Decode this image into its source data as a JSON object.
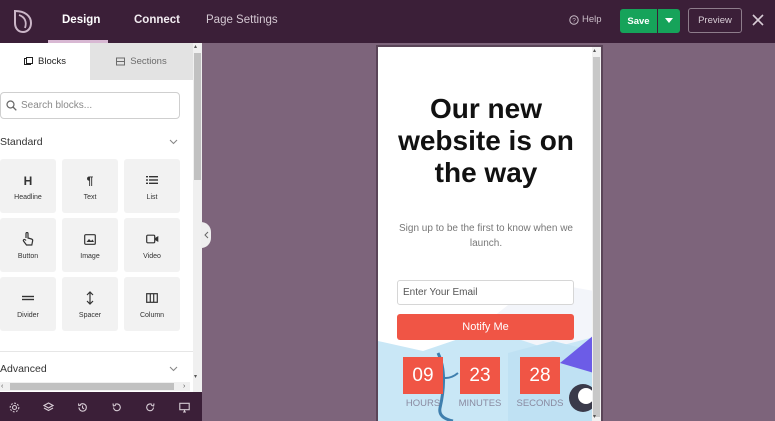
{
  "header": {
    "tabs": [
      {
        "label": "Design",
        "active": true
      },
      {
        "label": "Connect",
        "active": false
      },
      {
        "label": "Page Settings",
        "active": false
      }
    ],
    "help_label": "Help",
    "save_label": "Save",
    "preview_label": "Preview"
  },
  "sidebar": {
    "tabs": [
      {
        "label": "Blocks",
        "active": true
      },
      {
        "label": "Sections",
        "active": false
      }
    ],
    "search_placeholder": "Search blocks...",
    "standard_title": "Standard",
    "advanced_title": "Advanced",
    "blocks": [
      {
        "label": "Headline",
        "icon": "heading-icon"
      },
      {
        "label": "Text",
        "icon": "paragraph-icon"
      },
      {
        "label": "List",
        "icon": "list-icon"
      },
      {
        "label": "Button",
        "icon": "pointer-icon"
      },
      {
        "label": "Image",
        "icon": "image-icon"
      },
      {
        "label": "Video",
        "icon": "video-icon"
      },
      {
        "label": "Divider",
        "icon": "divider-icon"
      },
      {
        "label": "Spacer",
        "icon": "spacer-icon"
      },
      {
        "label": "Column",
        "icon": "column-icon"
      }
    ]
  },
  "toolbar": {
    "icons": [
      "settings-icon",
      "layers-icon",
      "history-icon",
      "undo-icon",
      "redo-icon",
      "desktop-icon"
    ]
  },
  "preview": {
    "headline": "Our new website is on the way",
    "subtext": "Sign up to be the first to know when we launch.",
    "email_placeholder": "Enter Your Email",
    "button_label": "Notify Me",
    "countdown": [
      {
        "value": "09",
        "label": "HOURS"
      },
      {
        "value": "23",
        "label": "MINUTES"
      },
      {
        "value": "28",
        "label": "SECONDS"
      }
    ]
  },
  "colors": {
    "topbar": "#3b1f38",
    "canvas": "#7d647b",
    "save": "#16a35a",
    "accent": "#f05545"
  }
}
